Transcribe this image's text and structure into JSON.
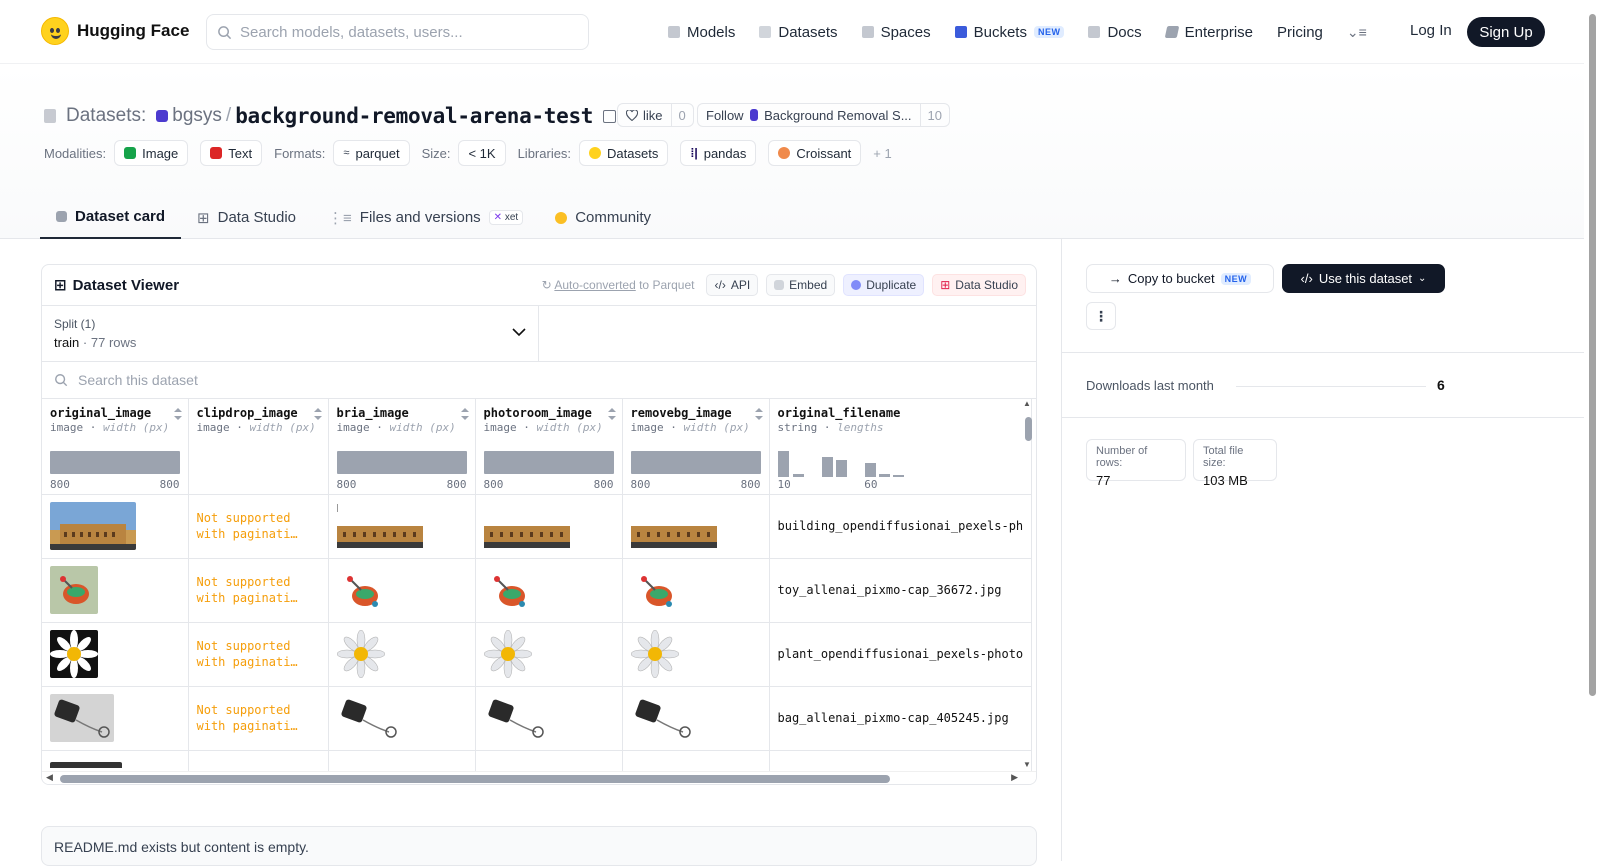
{
  "nav": {
    "brand": "Hugging Face",
    "search_placeholder": "Search models, datasets, users...",
    "links": [
      {
        "label": "Models"
      },
      {
        "label": "Datasets"
      },
      {
        "label": "Spaces"
      },
      {
        "label": "Buckets",
        "badge": "NEW"
      },
      {
        "label": "Docs"
      },
      {
        "label": "Enterprise"
      },
      {
        "label": "Pricing"
      }
    ],
    "login": "Log In",
    "signup": "Sign Up"
  },
  "header": {
    "prefix": "Datasets:",
    "org": "bgsys",
    "slash": "/",
    "name": "background-removal-arena-test",
    "like_label": "like",
    "like_count": "0",
    "follow_label": "Follow",
    "follow_org": "Background Removal S...",
    "follow_count": "10"
  },
  "tags": {
    "modalities_label": "Modalities:",
    "modalities": [
      "Image",
      "Text"
    ],
    "formats_label": "Formats:",
    "formats": [
      "parquet"
    ],
    "size_label": "Size:",
    "size": "< 1K",
    "libraries_label": "Libraries:",
    "libraries": [
      "Datasets",
      "pandas",
      "Croissant"
    ],
    "more": "+ 1"
  },
  "tabs": [
    "Dataset card",
    "Data Studio",
    "Files and versions",
    "Community"
  ],
  "tabs_xet": "xet",
  "viewer": {
    "title": "Dataset Viewer",
    "autoconv_link": "Auto-converted",
    "autoconv_rest": " to Parquet",
    "api": "API",
    "embed": "Embed",
    "duplicate": "Duplicate",
    "data_studio": "Data Studio",
    "split_label": "Split (1)",
    "split_name": "train",
    "split_rows": "77 rows",
    "search_placeholder": "Search this dataset",
    "columns": [
      {
        "name": "original_image",
        "type": "image",
        "stat": "width (px)",
        "min": "800",
        "max": "800"
      },
      {
        "name": "clipdrop_image",
        "type": "image",
        "stat": "width (px)",
        "min": "",
        "max": ""
      },
      {
        "name": "bria_image",
        "type": "image",
        "stat": "width (px)",
        "min": "800",
        "max": "800"
      },
      {
        "name": "photoroom_image",
        "type": "image",
        "stat": "width (px)",
        "min": "800",
        "max": "800"
      },
      {
        "name": "removebg_image",
        "type": "image",
        "stat": "width (px)",
        "min": "800",
        "max": "800"
      },
      {
        "name": "original_filename",
        "type": "string",
        "stat": "lengths",
        "min": "10",
        "max": "60"
      }
    ],
    "not_supported": [
      "Not supported",
      "with paginati…"
    ],
    "rows": [
      {
        "filename": "building_opendiffusionai_pexels-ph"
      },
      {
        "filename": "toy_allenai_pixmo-cap_36672.jpg"
      },
      {
        "filename": "plant_opendiffusionai_pexels-photo"
      },
      {
        "filename": "bag_allenai_pixmo-cap_405245.jpg"
      }
    ]
  },
  "readme": "README.md exists but content is empty.",
  "sidebar": {
    "copy_bucket": "Copy to bucket",
    "copy_badge": "NEW",
    "use_dataset": "Use this dataset",
    "downloads_label": "Downloads last month",
    "downloads_value": "6",
    "rows_label": "Number of rows:",
    "rows_value": "77",
    "size_label": "Total file size:",
    "size_value": "103 MB"
  }
}
